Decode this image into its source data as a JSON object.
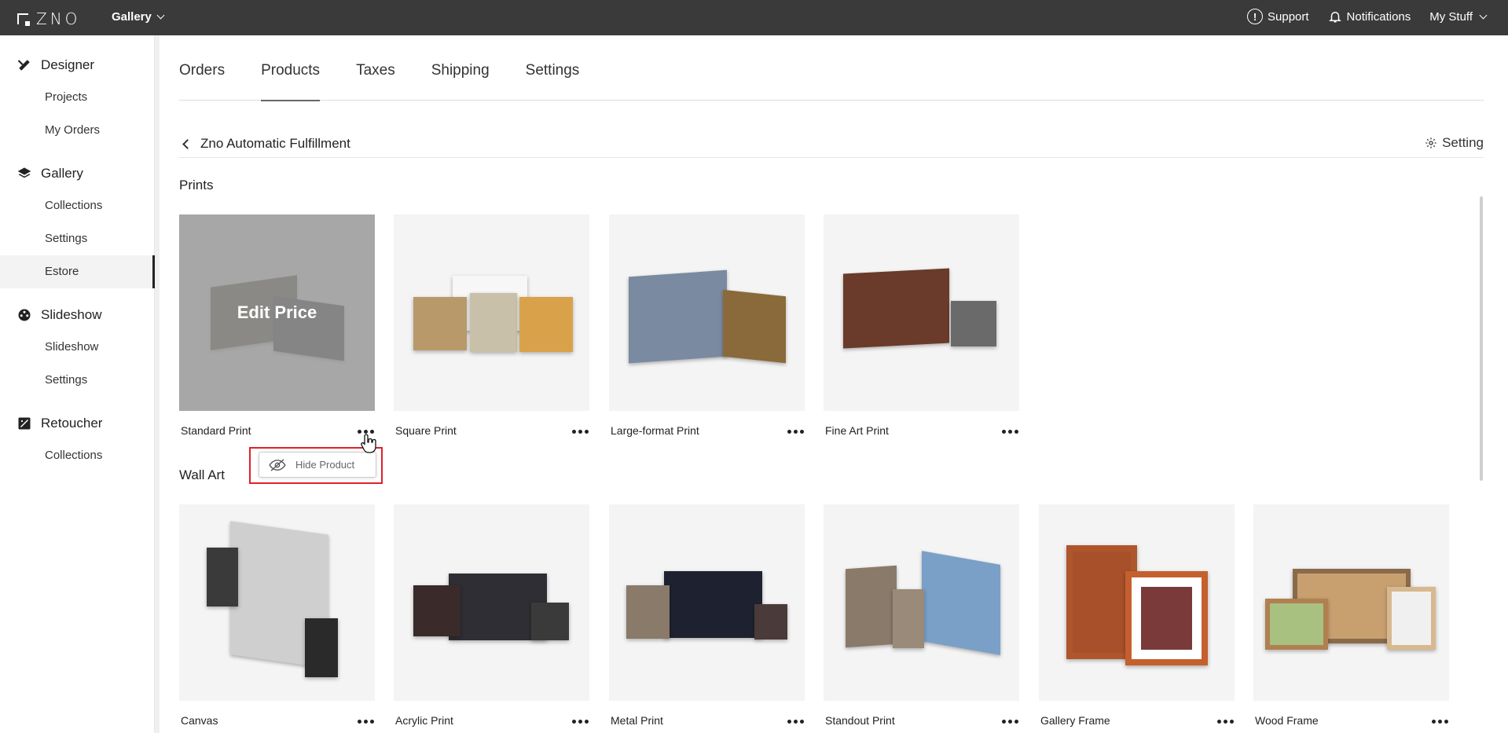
{
  "topbar": {
    "logo_text": "ZNO",
    "app_switch": "Gallery",
    "support": "Support",
    "notifications": "Notifications",
    "my_stuff": "My Stuff"
  },
  "sidebar": {
    "designer": {
      "label": "Designer",
      "items": [
        "Projects",
        "My Orders"
      ]
    },
    "gallery": {
      "label": "Gallery",
      "items": [
        "Collections",
        "Settings",
        "Estore"
      ]
    },
    "slideshow": {
      "label": "Slideshow",
      "items": [
        "Slideshow",
        "Settings"
      ]
    },
    "retoucher": {
      "label": "Retoucher",
      "items": [
        "Collections"
      ]
    },
    "active_item": "Estore"
  },
  "tabs": [
    "Orders",
    "Products",
    "Taxes",
    "Shipping",
    "Settings"
  ],
  "active_tab": "Products",
  "breadcrumb": {
    "back_label": "Zno Automatic Fulfillment",
    "setting_label": "Setting"
  },
  "sections": {
    "prints": {
      "title": "Prints",
      "products": [
        "Standard Print",
        "Square Print",
        "Large-format Print",
        "Fine Art Print"
      ]
    },
    "wall_art": {
      "title": "Wall Art",
      "products": [
        "Canvas",
        "Acrylic Print",
        "Metal Print",
        "Standout Print",
        "Gallery Frame",
        "Wood Frame"
      ]
    }
  },
  "hover_overlay": "Edit Price",
  "popup": {
    "hide_label": "Hide Product"
  },
  "colors": {
    "topbar": "#3a3a3a",
    "highlight": "#e0202a"
  }
}
